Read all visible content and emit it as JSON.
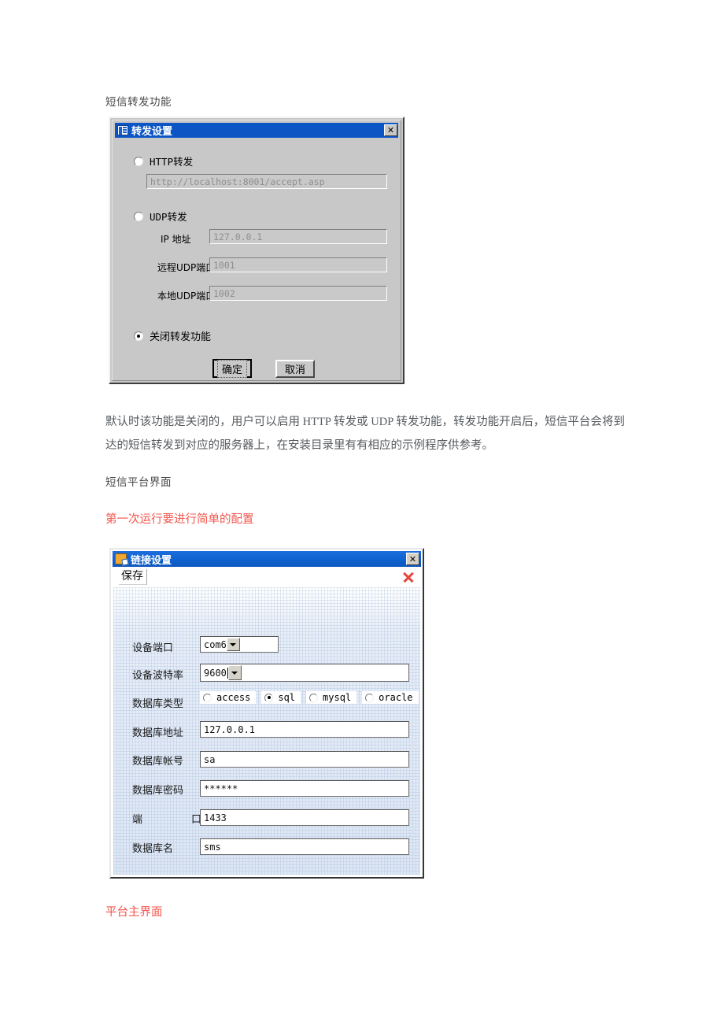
{
  "document": {
    "heading_forward": "短信转发功能",
    "paragraph_forward": "默认时该功能是关闭的，用户可以启用 HTTP 转发或 UDP 转发功能，转发功能开启后，短信平台会将到达的短信转发到对应的服务器上，在安装目录里有有相应的示例程序供参考。",
    "heading_platform": "短信平台界面",
    "note_first_run": "第一次运行要进行简单的配置",
    "note_main_ui": "平台主界面",
    "red_color": "#f4554c"
  },
  "forward_dialog": {
    "title": "转发设置",
    "close_label": "✕",
    "http_option": {
      "label": "HTTP转发",
      "selected": false,
      "url_value": "http://localhost:8001/accept.asp"
    },
    "udp_option": {
      "label": "UDP转发",
      "selected": false,
      "fields": [
        {
          "label": "IP 地址",
          "value": "127.0.0.1"
        },
        {
          "label": "远程UDP端口",
          "value": "1001"
        },
        {
          "label": "本地UDP端口",
          "value": "1002"
        }
      ]
    },
    "disable_option": {
      "label": "关闭转发功能",
      "selected": true
    },
    "buttons": {
      "ok": "确定",
      "cancel": "取消"
    }
  },
  "link_dialog": {
    "title": "链接设置",
    "close_label": "✕",
    "toolbar": {
      "save_label": "保存",
      "delete_icon": "red-x-icon"
    },
    "fields": [
      {
        "label": "设备端口",
        "value": "com6",
        "type": "combo"
      },
      {
        "label": "设备波特率",
        "value": "9600",
        "type": "combo-wide",
        "caret": true
      },
      {
        "label": "数据库地址",
        "value": "127.0.0.1",
        "type": "text"
      },
      {
        "label": "数据库帐号",
        "value": "sa",
        "type": "text"
      },
      {
        "label": "数据库密码",
        "value": "******",
        "type": "text"
      },
      {
        "label": "端　　口",
        "value": "1433",
        "type": "text"
      },
      {
        "label": "数据库名",
        "value": "sms",
        "type": "text"
      }
    ],
    "db_type": {
      "label": "数据库类型",
      "options": [
        {
          "label": "access",
          "selected": false
        },
        {
          "label": "sql",
          "selected": true
        },
        {
          "label": "mysql",
          "selected": false
        },
        {
          "label": "oracle",
          "selected": false
        }
      ]
    }
  }
}
